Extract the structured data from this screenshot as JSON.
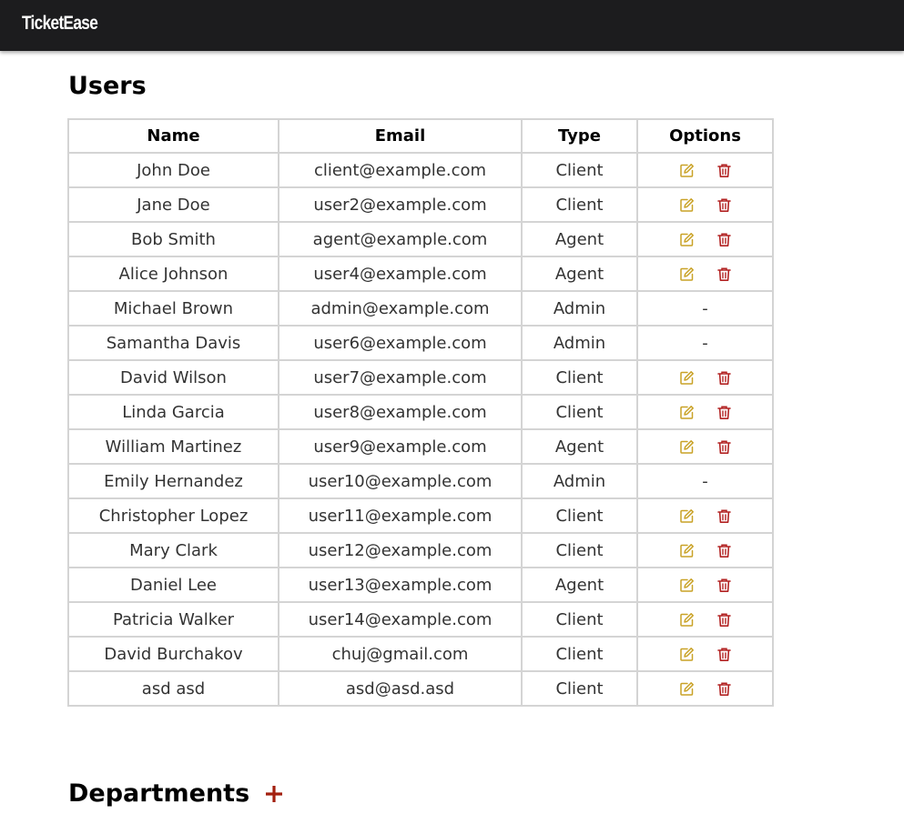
{
  "app": {
    "brand": "TicketEase"
  },
  "colors": {
    "topbar": "#1c1c1e",
    "edit_icon": "#c9a227",
    "delete_icon": "#b22222",
    "add_icon": "#a3200f",
    "border": "#d4d4d4"
  },
  "users_section": {
    "title": "Users",
    "columns": [
      "Name",
      "Email",
      "Type",
      "Options"
    ],
    "no_options_text": "-",
    "rows": [
      {
        "name": "John Doe",
        "email": "client@example.com",
        "type": "Client",
        "editable": true
      },
      {
        "name": "Jane Doe",
        "email": "user2@example.com",
        "type": "Client",
        "editable": true
      },
      {
        "name": "Bob Smith",
        "email": "agent@example.com",
        "type": "Agent",
        "editable": true
      },
      {
        "name": "Alice Johnson",
        "email": "user4@example.com",
        "type": "Agent",
        "editable": true
      },
      {
        "name": "Michael Brown",
        "email": "admin@example.com",
        "type": "Admin",
        "editable": false
      },
      {
        "name": "Samantha Davis",
        "email": "user6@example.com",
        "type": "Admin",
        "editable": false
      },
      {
        "name": "David Wilson",
        "email": "user7@example.com",
        "type": "Client",
        "editable": true
      },
      {
        "name": "Linda Garcia",
        "email": "user8@example.com",
        "type": "Client",
        "editable": true
      },
      {
        "name": "William Martinez",
        "email": "user9@example.com",
        "type": "Agent",
        "editable": true
      },
      {
        "name": "Emily Hernandez",
        "email": "user10@example.com",
        "type": "Admin",
        "editable": false
      },
      {
        "name": "Christopher Lopez",
        "email": "user11@example.com",
        "type": "Client",
        "editable": true
      },
      {
        "name": "Mary Clark",
        "email": "user12@example.com",
        "type": "Client",
        "editable": true
      },
      {
        "name": "Daniel Lee",
        "email": "user13@example.com",
        "type": "Agent",
        "editable": true
      },
      {
        "name": "Patricia Walker",
        "email": "user14@example.com",
        "type": "Client",
        "editable": true
      },
      {
        "name": "David Burchakov",
        "email": "chuj@gmail.com",
        "type": "Client",
        "editable": true
      },
      {
        "name": "asd asd",
        "email": "asd@asd.asd",
        "type": "Client",
        "editable": true
      }
    ]
  },
  "departments_section": {
    "title": "Departments"
  }
}
